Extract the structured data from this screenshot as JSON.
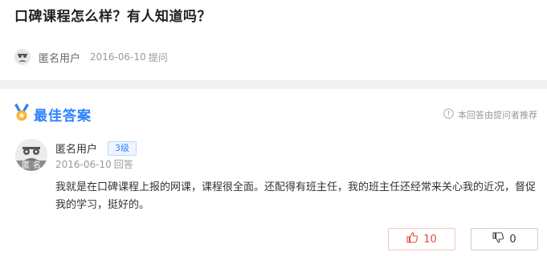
{
  "question": {
    "title": "口碑课程怎么样？有人知道吗？",
    "asker": "匿名用户",
    "date": "2016-06-10",
    "asked_label": "提问"
  },
  "best_answer": {
    "heading": "最佳答案",
    "recommend_label": "本回答由提问者推荐",
    "user": "匿名用户",
    "level": "3级",
    "avatar_tag": "匿名",
    "date": "2016-06-10",
    "answered_label": "回答",
    "content": "我就是在口碑课程上报的网课，课程很全面。还配得有班主任，我的班主任还经常来关心我的近况，督促我的学习，挺好的。",
    "upvotes": "10",
    "downvotes": "0"
  },
  "colors": {
    "accent": "#2e82ff",
    "upvote": "#e24b3a",
    "divider": "#f1f1f1"
  },
  "icons": [
    "anonymous-avatar-icon",
    "best-answer-medal-icon",
    "info-circle-icon",
    "thumbs-up-icon",
    "thumbs-down-icon"
  ]
}
